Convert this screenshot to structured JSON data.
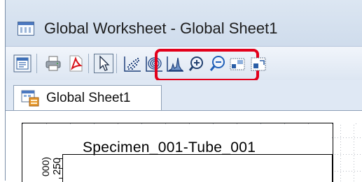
{
  "window": {
    "title": "Global Worksheet - Global Sheet1"
  },
  "toolbar": {
    "buttons": [
      {
        "name": "worksheet-view-icon",
        "pressed": false
      },
      {
        "name": "print-icon",
        "pressed": false
      },
      {
        "name": "pdf-export-icon",
        "pressed": false
      },
      {
        "name": "pointer-tool-icon",
        "pressed": true
      },
      {
        "name": "dot-plot-tool-icon",
        "pressed": false
      },
      {
        "name": "contour-plot-tool-icon",
        "pressed": false
      },
      {
        "name": "histogram-tool-icon",
        "pressed": false
      },
      {
        "name": "zoom-in-icon",
        "pressed": false
      },
      {
        "name": "zoom-out-icon",
        "pressed": false
      },
      {
        "name": "grid-layout-icon",
        "pressed": false
      },
      {
        "name": "fit-page-icon",
        "pressed": false
      }
    ],
    "highlight_color": "#e3001b"
  },
  "tabs": [
    {
      "label": "Global Sheet1",
      "active": true
    }
  ],
  "plot": {
    "title": "Specimen_001-Tube_001",
    "y_tick_label": "250",
    "y_axis_label_fragment": "000)"
  },
  "colors": {
    "chrome": "#dfe8f4",
    "title_bar": "#cfdcec",
    "accent_blue": "#4b78c0"
  }
}
